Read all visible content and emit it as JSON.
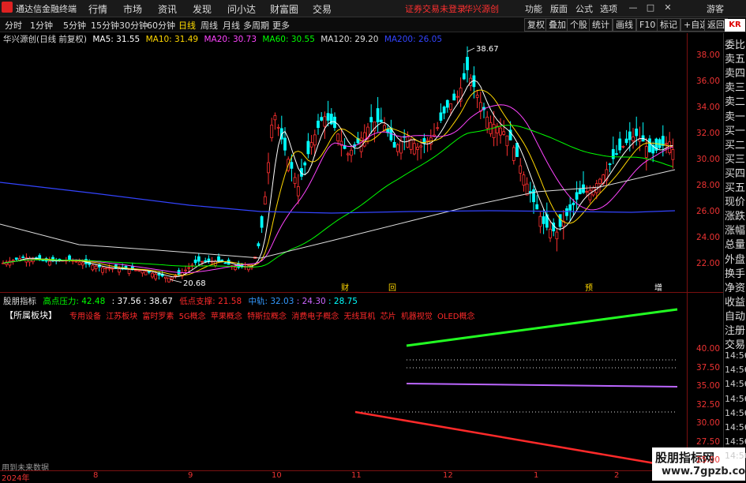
{
  "titlebar": {
    "app_title": "通达信金融终端",
    "menus": [
      "行情",
      "市场",
      "资讯",
      "发现",
      "问小达",
      "财富圈",
      "交易"
    ],
    "login_status": "证券交易未登录",
    "stock_name": "华兴源创",
    "right_menus": [
      "功能",
      "版面",
      "公式",
      "选项"
    ],
    "guest": "游客"
  },
  "toolbar": {
    "periods": [
      "分时",
      "1分钟",
      "5分钟",
      "15分钟",
      "30分钟",
      "60分钟",
      "日线",
      "周线",
      "月线",
      "多周期",
      "更多"
    ],
    "active_period": "日线",
    "buttons": [
      "复权",
      "叠加",
      "个股",
      "统计",
      "画线",
      "F10",
      "标记",
      "+自选",
      "返回"
    ]
  },
  "legend": {
    "name": "华兴源创(日线 前复权)",
    "ma": [
      {
        "label": "MA5: 31.55",
        "color": "#ffffff"
      },
      {
        "label": "MA10: 31.49",
        "color": "#ffd700"
      },
      {
        "label": "MA20: 30.73",
        "color": "#ff44ff"
      },
      {
        "label": "MA60: 30.55",
        "color": "#00ff00"
      },
      {
        "label": "MA120: 29.20",
        "color": "#dddddd"
      },
      {
        "label": "MA200: 26.05",
        "color": "#3344ff"
      }
    ]
  },
  "right_panel": [
    "委比",
    "卖五",
    "卖四",
    "卖三",
    "卖二",
    "卖一",
    "买一",
    "买二",
    "买三",
    "买四",
    "买五",
    "现价",
    "涨跌",
    "涨幅",
    "总量",
    "外盘",
    "换手",
    "净资",
    "收益",
    "自动",
    "注册",
    "交易",
    "14:56",
    "14:56",
    "14:56",
    "14:56",
    "14:56",
    "14:56",
    "14:56",
    "14:56"
  ],
  "right_panel_top": "KR",
  "main_yaxis": [
    "38.00",
    "36.00",
    "34.00",
    "32.00",
    "30.00",
    "28.00",
    "26.00",
    "24.00",
    "22.00"
  ],
  "annotations": {
    "high": "38.67",
    "low": "20.68"
  },
  "event_markers": [
    "财",
    "回",
    "预",
    "增"
  ],
  "indicator": {
    "name": "股朋指标",
    "items": [
      {
        "label": "高点压力: 42.48",
        "color": "#00ff00"
      },
      {
        "label": ": 37.56",
        "color": "#ffffff"
      },
      {
        "label": ": 38.67",
        "color": "#ffffff"
      },
      {
        "label": "低点支撑: 21.58",
        "color": "#ff2a2a"
      },
      {
        "label": "中轨: 32.03",
        "color": "#3399ff"
      },
      {
        "label": ": 24.30",
        "color": "#cc66ff"
      },
      {
        "label": ": 28.75",
        "color": "#00ffff"
      }
    ],
    "block_label": "【所属板块】",
    "blocks": [
      "专用设备",
      "江苏板块",
      "富时罗素",
      "5G概念",
      "苹果概念",
      "特斯拉概念",
      "消费电子概念",
      "无线耳机",
      "芯片",
      "机器视觉",
      "OLED概念"
    ],
    "yaxis": [
      "40.00",
      "37.50",
      "35.00",
      "32.50",
      "30.00",
      "27.50",
      "25.00"
    ]
  },
  "future_data": "用到未来数据",
  "date_axis": [
    "2024年",
    "8",
    "9",
    "10",
    "11",
    "12",
    "1",
    "2"
  ],
  "watermark": {
    "line1": "股朋指标网",
    "line2": "www.7gpzb.com"
  },
  "colors": {
    "up": "#ff3030",
    "down": "#00ffff",
    "axis": "#7a1010"
  }
}
